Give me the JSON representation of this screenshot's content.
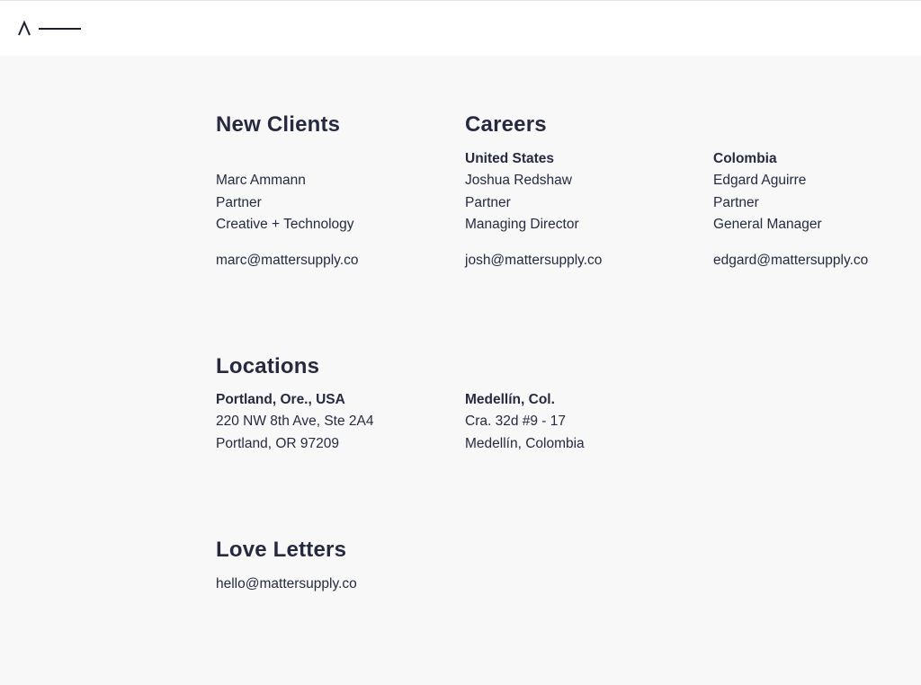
{
  "header": {
    "logo_icon": "matter-supply-logo-icon"
  },
  "new_clients": {
    "heading": "New Clients",
    "name": "Marc Ammann",
    "role": "Partner",
    "department": "Creative + Technology",
    "email": "marc@mattersupply.co"
  },
  "careers": {
    "heading": "Careers",
    "contacts": [
      {
        "region": "United States",
        "name": "Joshua Redshaw",
        "role": "Partner",
        "title": "Managing Director",
        "email": "josh@mattersupply.co"
      },
      {
        "region": "Colombia",
        "name": "Edgard Aguirre",
        "role": "Partner",
        "title": "General Manager",
        "email": "edgard@mattersupply.co"
      }
    ]
  },
  "locations": {
    "heading": "Locations",
    "offices": [
      {
        "city": "Portland, Ore., USA",
        "street": "220 NW 8th Ave, Ste 2A4",
        "locality": "Portland, OR 97209"
      },
      {
        "city": "Medellín, Col.",
        "street": "Cra. 32d #9 - 17",
        "locality": "Medellín, Colombia"
      }
    ]
  },
  "love_letters": {
    "heading": "Love Letters",
    "email": "hello@mattersupply.co"
  },
  "colors": {
    "text": "#262a3f",
    "background": "#f8f8f9",
    "header_background": "#ffffff"
  }
}
